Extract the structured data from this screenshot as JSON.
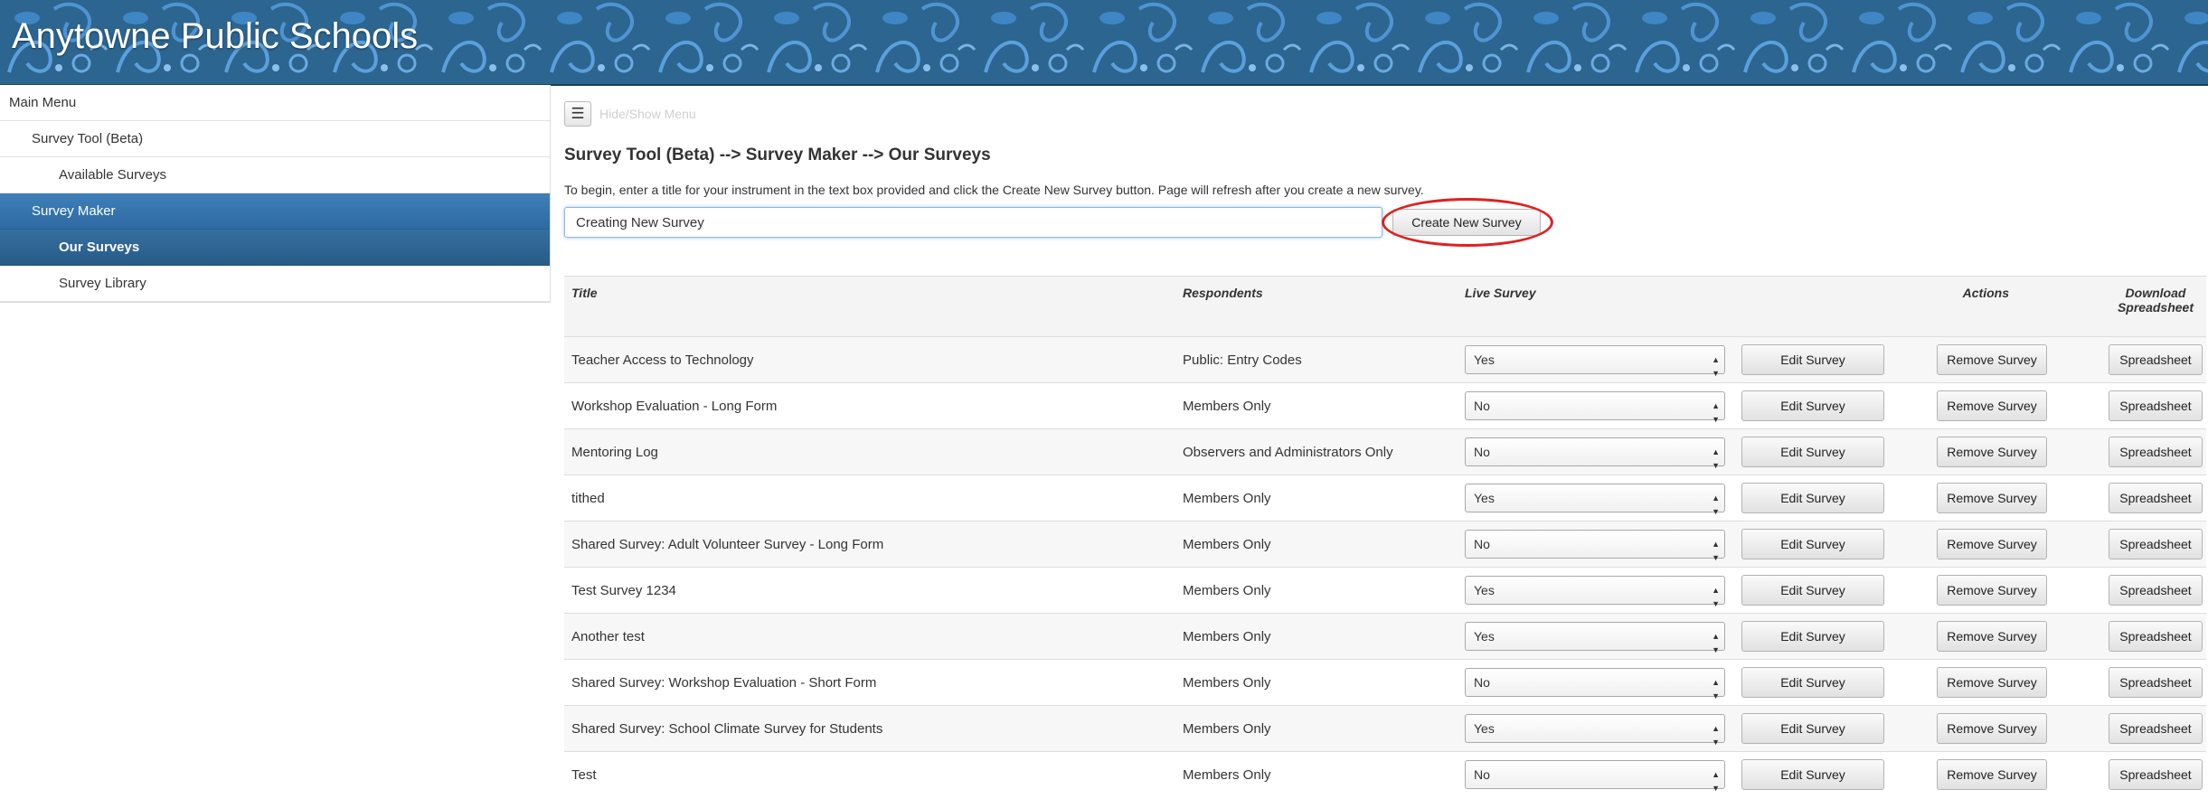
{
  "header": {
    "title": "Anytowne Public Schools"
  },
  "sidebar": {
    "items": [
      {
        "label": "Main Menu",
        "level": 0,
        "active": ""
      },
      {
        "label": "Survey Tool (Beta)",
        "level": 1,
        "active": ""
      },
      {
        "label": "Available Surveys",
        "level": 2,
        "active": ""
      },
      {
        "label": "Survey Maker",
        "level": 1,
        "active": "active1"
      },
      {
        "label": "Our Surveys",
        "level": 2,
        "active": "active2"
      },
      {
        "label": "Survey Library",
        "level": 2,
        "active": ""
      }
    ]
  },
  "toolbar": {
    "toggle_icon": "☰",
    "toggle_label": "Hide/Show Menu"
  },
  "main": {
    "breadcrumb": "Survey Tool (Beta) --> Survey Maker --> Our Surveys",
    "instructions": "To begin, enter a title for your instrument in the text box provided and click the Create New Survey button. Page will refresh after you create a new survey.",
    "new_title_value": "Creating New Survey",
    "create_button": "Create New Survey"
  },
  "table": {
    "headers": {
      "title": "Title",
      "respondents": "Respondents",
      "live": "Live Survey",
      "actions": "Actions",
      "download_line1": "Download",
      "download_line2": "Spreadsheet"
    },
    "edit_label": "Edit Survey",
    "remove_label": "Remove Survey",
    "sheet_label": "Spreadsheet",
    "rows": [
      {
        "title": "Teacher Access to Technology",
        "respondents": "Public: Entry Codes",
        "live": "Yes"
      },
      {
        "title": "Workshop Evaluation - Long Form",
        "respondents": "Members Only",
        "live": "No"
      },
      {
        "title": "Mentoring Log",
        "respondents": "Observers and Administrators Only",
        "live": "No"
      },
      {
        "title": "tithed",
        "respondents": "Members Only",
        "live": "Yes"
      },
      {
        "title": "Shared Survey: Adult Volunteer Survey - Long Form",
        "respondents": "Members Only",
        "live": "No"
      },
      {
        "title": "Test Survey 1234",
        "respondents": "Members Only",
        "live": "Yes"
      },
      {
        "title": "Another test",
        "respondents": "Members Only",
        "live": "Yes"
      },
      {
        "title": "Shared Survey: Workshop Evaluation - Short Form",
        "respondents": "Members Only",
        "live": "No"
      },
      {
        "title": "Shared Survey: School Climate Survey for Students",
        "respondents": "Members Only",
        "live": "Yes"
      },
      {
        "title": "Test",
        "respondents": "Members Only",
        "live": "No"
      }
    ]
  }
}
